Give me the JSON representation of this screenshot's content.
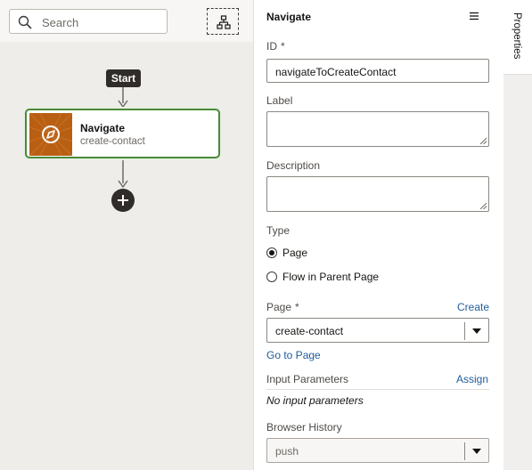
{
  "search": {
    "placeholder": "Search"
  },
  "diagram": {
    "start_label": "Start",
    "node": {
      "title": "Navigate",
      "subtitle": "create-contact"
    }
  },
  "panel": {
    "title": "Navigate",
    "id": {
      "label": "ID",
      "required_mark": "*",
      "value": "navigateToCreateContact"
    },
    "label_field": {
      "label": "Label",
      "value": ""
    },
    "description": {
      "label": "Description",
      "value": ""
    },
    "type": {
      "label": "Type",
      "options": [
        {
          "label": "Page",
          "selected": true
        },
        {
          "label": "Flow in Parent Page",
          "selected": false
        }
      ]
    },
    "page": {
      "label": "Page",
      "required_mark": "*",
      "create_link": "Create",
      "value": "create-contact",
      "goto_link": "Go to Page"
    },
    "input_parameters": {
      "label": "Input Parameters",
      "assign_link": "Assign",
      "empty_text": "No input parameters"
    },
    "browser_history": {
      "label": "Browser History",
      "value": "push"
    }
  },
  "tabs": {
    "properties": "Properties"
  },
  "icons": {
    "search": "search-icon",
    "diagram": "diagram-icon",
    "node": "compass-icon",
    "add": "plus-icon",
    "menu": "hamburger-icon"
  },
  "colors": {
    "accent_link": "#1f5c99",
    "node_border": "#4a8a3a",
    "node_thumb": "#b85f14"
  }
}
